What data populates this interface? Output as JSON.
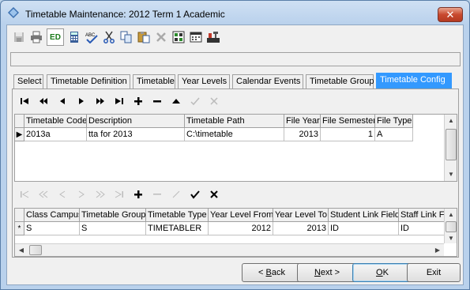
{
  "window": {
    "title": "Timetable Maintenance:  2012 Term 1 Academic",
    "close_label": "✕"
  },
  "toolbar": {
    "buttons": [
      {
        "icon": "save-icon",
        "enabled": false
      },
      {
        "icon": "print-icon",
        "enabled": true
      },
      {
        "icon": "edit-mode-icon",
        "label": "ED",
        "enabled": true,
        "pressed": true
      },
      {
        "icon": "calculator-icon",
        "enabled": true
      },
      {
        "icon": "spellcheck-icon",
        "enabled": true
      },
      {
        "icon": "cut-icon",
        "enabled": true
      },
      {
        "icon": "copy-icon",
        "enabled": true
      },
      {
        "icon": "paste-icon",
        "enabled": true
      },
      {
        "icon": "delete-icon",
        "enabled": false
      },
      {
        "icon": "grid-icon",
        "enabled": true
      },
      {
        "icon": "calendar-icon",
        "enabled": true
      },
      {
        "icon": "tools-icon",
        "enabled": true
      }
    ]
  },
  "tabs": [
    {
      "label": "Select",
      "active": false
    },
    {
      "label": "Timetable Definition",
      "active": false
    },
    {
      "label": "Timetable",
      "active": false
    },
    {
      "label": "Year Levels",
      "active": false
    },
    {
      "label": "Calendar Events",
      "active": false
    },
    {
      "label": "Timetable Group",
      "active": false
    },
    {
      "label": "Timetable Config",
      "active": true
    }
  ],
  "upper_nav": {
    "buttons": [
      "first-icon",
      "prior-page-icon",
      "prior-icon",
      "next-icon",
      "next-page-icon",
      "last-icon",
      "insert-icon",
      "delete-icon",
      "edit-icon",
      "post-icon",
      "cancel-icon"
    ]
  },
  "upper_grid": {
    "columns": [
      "Timetable Code",
      "Description",
      "Timetable Path",
      "File Year",
      "File Semester",
      "File Type"
    ],
    "rows": [
      {
        "indicator": "▶",
        "cells": [
          "2013a",
          "tta for 2013",
          "C:\\timetable",
          "2013",
          "1",
          "A"
        ]
      }
    ]
  },
  "lower_nav": {
    "buttons": [
      "first-icon",
      "prior-page-icon",
      "prior-icon",
      "next-icon",
      "next-page-icon",
      "last-icon",
      "insert-icon",
      "delete-icon",
      "edit-icon",
      "post-icon",
      "cancel-icon"
    ]
  },
  "lower_grid": {
    "columns": [
      "Class Campus",
      "Timetable Group",
      "Timetable Type",
      "Year Level From",
      "Year Level To",
      "Student Link Field",
      "Staff Link Fi"
    ],
    "rows": [
      {
        "indicator": "*",
        "cells": [
          "S",
          "S",
          "TIMETABLER",
          "2012",
          "2013",
          "ID",
          "ID"
        ]
      }
    ]
  },
  "footer": {
    "back_prefix": "< ",
    "back_mnemonic": "B",
    "back_rest": "ack",
    "next_prefix": "",
    "next_mnemonic": "N",
    "next_rest": "ext >",
    "ok_mnemonic": "O",
    "ok_rest": "K",
    "exit_label": "Exit"
  }
}
